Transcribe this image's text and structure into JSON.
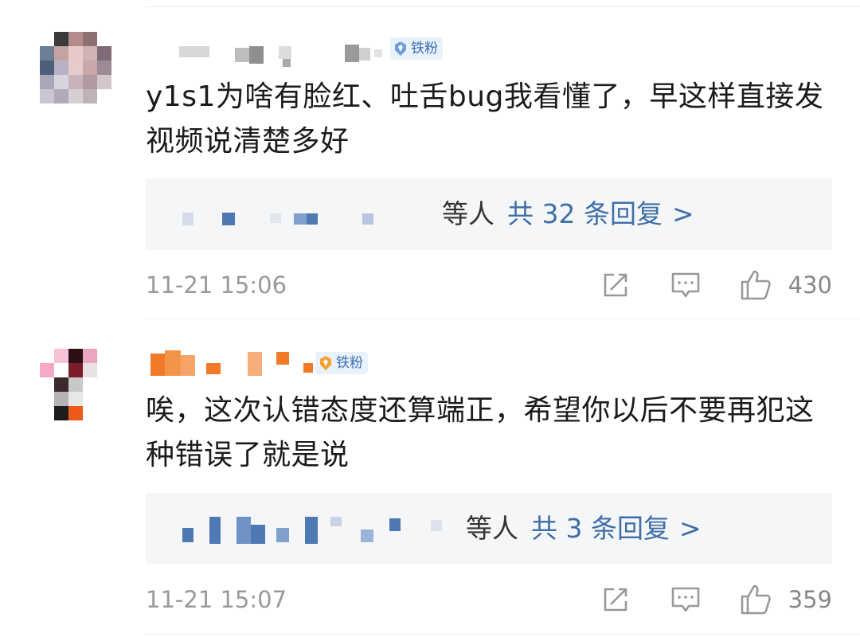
{
  "comments": [
    {
      "badge": "铁粉",
      "text": "y1s1为啥有脸红、吐舌bug我看懂了，早这样直接发视频说清楚多好",
      "reply_suffix": "等人",
      "reply_count": "共 32 条回复",
      "reply_chevron": ">",
      "time": "11-21 15:06",
      "likes": "430"
    },
    {
      "badge": "铁粉",
      "text": "唉，这次认错态度还算端正，希望你以后不要再犯这种错误了就是说",
      "reply_suffix": "等人",
      "reply_count": "共 3 条回复",
      "reply_chevron": ">",
      "time": "11-21 15:07",
      "likes": "359"
    }
  ],
  "icons": {
    "share": "share-icon",
    "comment": "comment-icon",
    "like": "thumbs-up-icon",
    "badge": "fan-badge-icon"
  },
  "colors": {
    "link_blue": "#3f6fa8",
    "badge_bg": "#e9f1fb",
    "badge_text": "#3c6fb0",
    "meta_gray": "#999999",
    "reply_bg": "#f5f6f7"
  }
}
